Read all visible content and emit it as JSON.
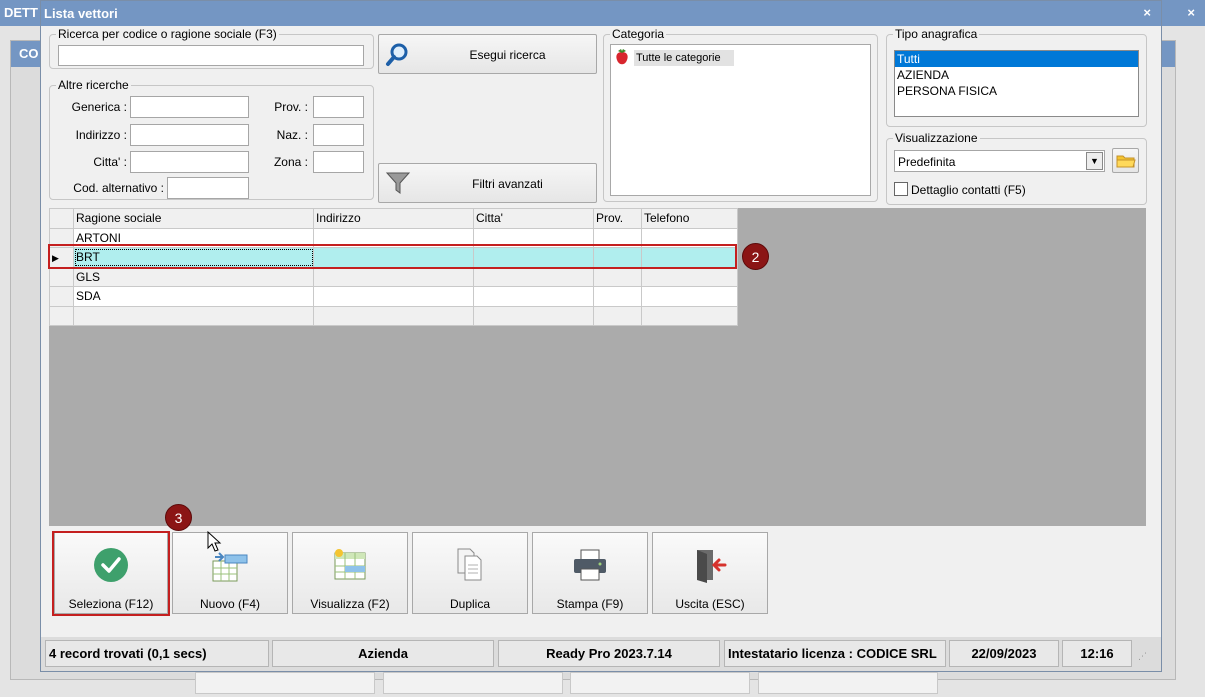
{
  "background": {
    "title": "DETT",
    "panel_title": "CO"
  },
  "window": {
    "title": "Lista vettori",
    "close_glyph": "×",
    "bg_close_glyph": "×"
  },
  "search": {
    "legend": "Ricerca per codice o ragione sociale (F3)",
    "value": "",
    "button_label": "Esegui ricerca"
  },
  "altre": {
    "legend": "Altre ricerche",
    "generica_label": "Generica :",
    "indirizzo_label": "Indirizzo :",
    "citta_label": "Citta' :",
    "cod_alt_label": "Cod. alternativo :",
    "prov_label": "Prov. :",
    "naz_label": "Naz. :",
    "zona_label": "Zona :",
    "filtri_label": "Filtri avanzati"
  },
  "categoria": {
    "legend": "Categoria",
    "items": [
      "Tutte le categorie"
    ]
  },
  "tipo": {
    "legend": "Tipo anagrafica",
    "items": [
      "Tutti",
      "AZIENDA",
      "PERSONA FISICA"
    ],
    "selected_index": 0
  },
  "visual": {
    "legend": "Visualizzazione",
    "selected": "Predefinita",
    "dettaglio_label": "Dettaglio contatti (F5)",
    "dettaglio_checked": false
  },
  "grid": {
    "columns": [
      "Ragione sociale",
      "Indirizzo",
      "Citta'",
      "Prov.",
      "Telefono"
    ],
    "rows": [
      [
        "ARTONI",
        "",
        "",
        "",
        ""
      ],
      [
        "BRT",
        "",
        "",
        "",
        ""
      ],
      [
        "GLS",
        "",
        "",
        "",
        ""
      ],
      [
        "SDA",
        "",
        "",
        "",
        ""
      ],
      [
        "",
        "",
        "",
        "",
        ""
      ]
    ],
    "current_row": 1,
    "row_marker": "▶"
  },
  "badges": {
    "b2": "2",
    "b3": "3"
  },
  "toolbar": {
    "seleziona": "Seleziona (F12)",
    "nuovo": "Nuovo (F4)",
    "visualizza": "Visualizza (F2)",
    "duplica": "Duplica",
    "stampa": "Stampa (F9)",
    "uscita": "Uscita (ESC)"
  },
  "status": {
    "records": "4 record trovati (0,1 secs)",
    "tipo": "Azienda",
    "version": "Ready Pro 2023.7.14",
    "licenza": "Intestatario licenza : CODICE SRL",
    "date": "22/09/2023",
    "time": "12:16"
  },
  "colors": {
    "titlebar": "#7496c3",
    "selection": "#0078d7",
    "current_row": "#b0eeee",
    "highlight": "#c41f1f",
    "badge": "#8b1515",
    "check_green": "#3ea06c"
  }
}
